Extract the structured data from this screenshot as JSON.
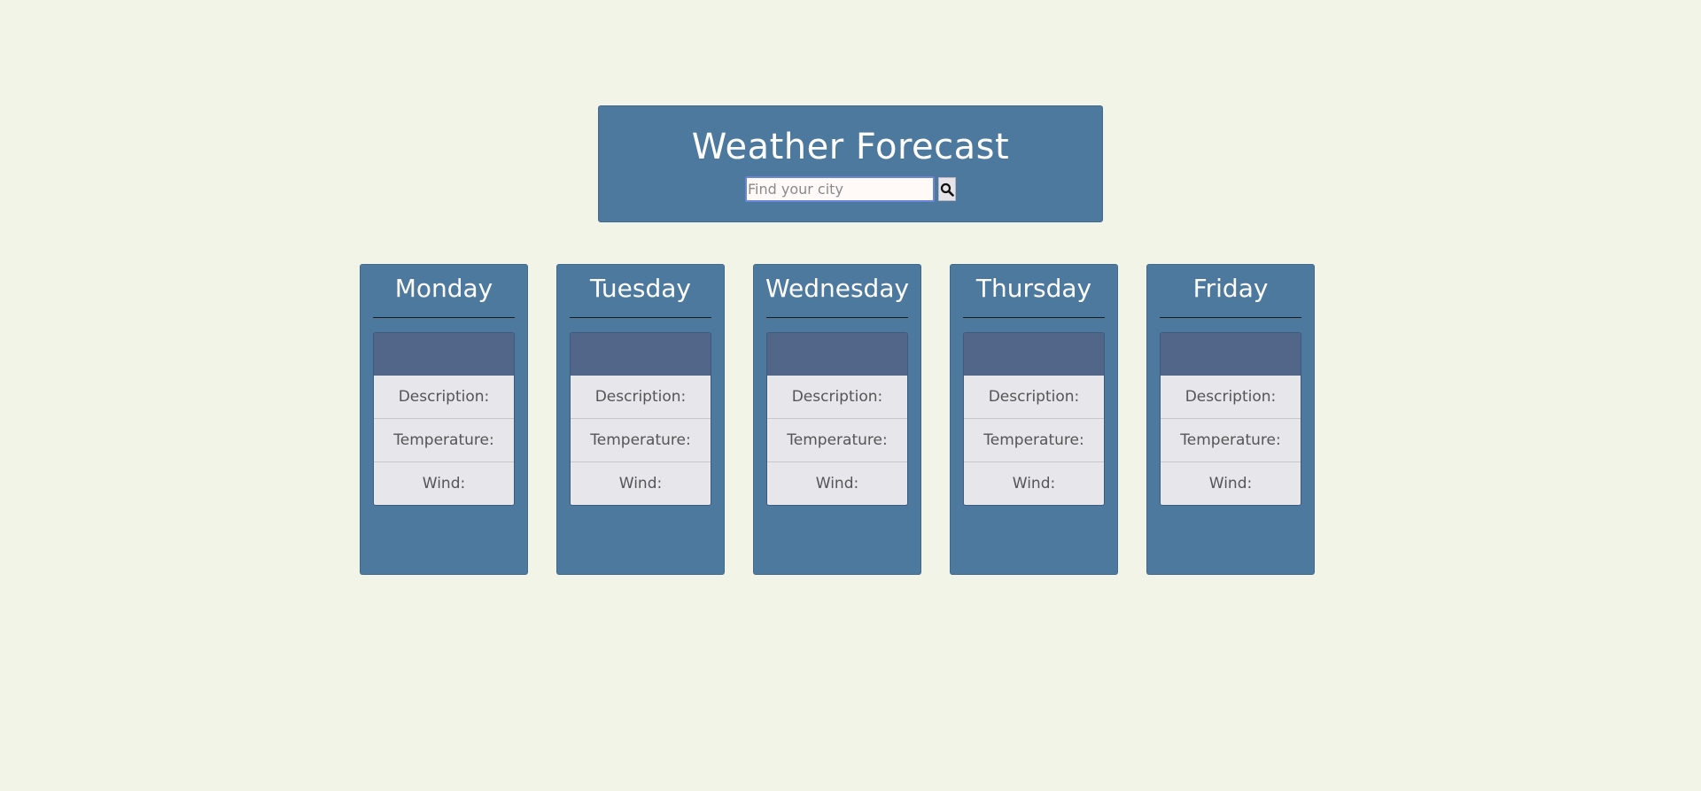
{
  "header": {
    "title": "Weather Forecast",
    "search": {
      "placeholder": "Find your city",
      "value": "",
      "button_icon": "search-icon"
    }
  },
  "forecast": {
    "days": [
      {
        "name": "Monday",
        "labels": [
          "Description:",
          "Temperature:",
          "Wind:"
        ]
      },
      {
        "name": "Tuesday",
        "labels": [
          "Description:",
          "Temperature:",
          "Wind:"
        ]
      },
      {
        "name": "Wednesday",
        "labels": [
          "Description:",
          "Temperature:",
          "Wind:"
        ]
      },
      {
        "name": "Thursday",
        "labels": [
          "Description:",
          "Temperature:",
          "Wind:"
        ]
      },
      {
        "name": "Friday",
        "labels": [
          "Description:",
          "Temperature:",
          "Wind:"
        ]
      }
    ]
  },
  "colors": {
    "background": "#f3f4e8",
    "card": "#4d799e",
    "card_header": "#516689",
    "row": "#e7e6ea"
  }
}
